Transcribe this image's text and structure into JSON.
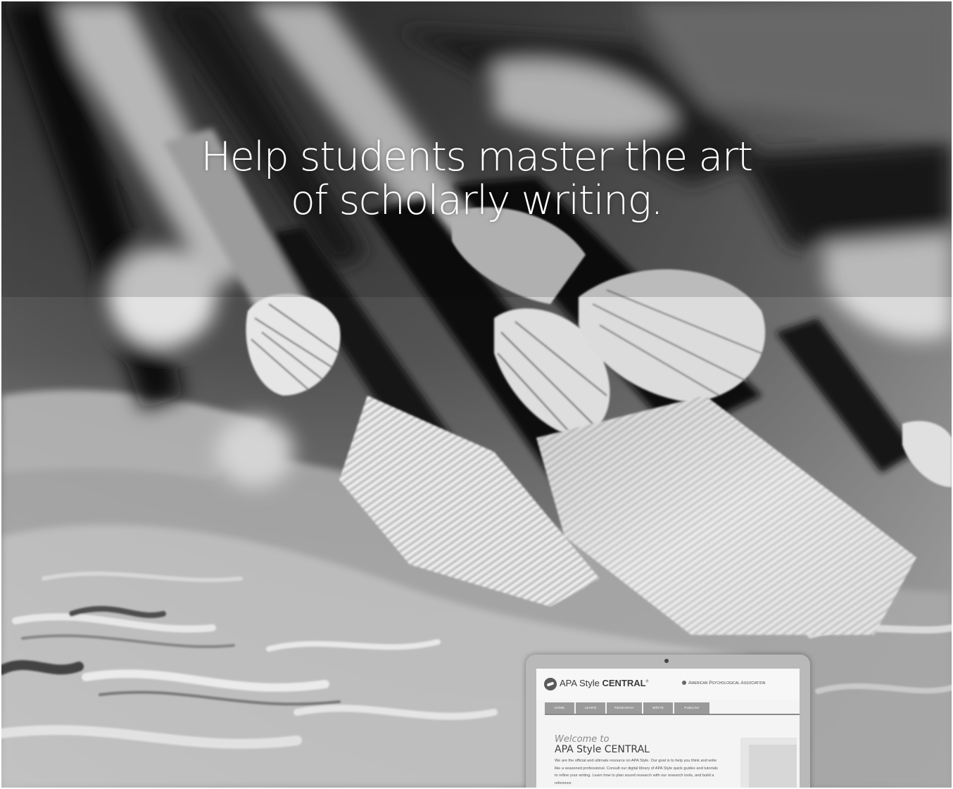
{
  "headline": {
    "line1": "Help students master the art",
    "line2": "of scholarly writing."
  },
  "laptop_screen": {
    "logo_text_regular": "APA Style ",
    "logo_text_bold": "CENTRAL",
    "logo_mark": "®",
    "association": "American Psychological Association",
    "nav": [
      "HOME",
      "LEARN",
      "RESEARCH",
      "WRITE",
      "PUBLISH"
    ],
    "welcome_to": "Welcome to",
    "welcome_title": "APA Style CENTRAL",
    "welcome_body": "We are the official and ultimate resource on APA Style. Our goal is to help you think and write like a seasoned professional. Consult our digital library of APA Style quick guides and tutorials to refine your writing. Learn how to plan sound research with our research tools, and build a reference"
  },
  "colors": {
    "headline": "#ffffff",
    "nav_bg": "#9a9a9a"
  }
}
